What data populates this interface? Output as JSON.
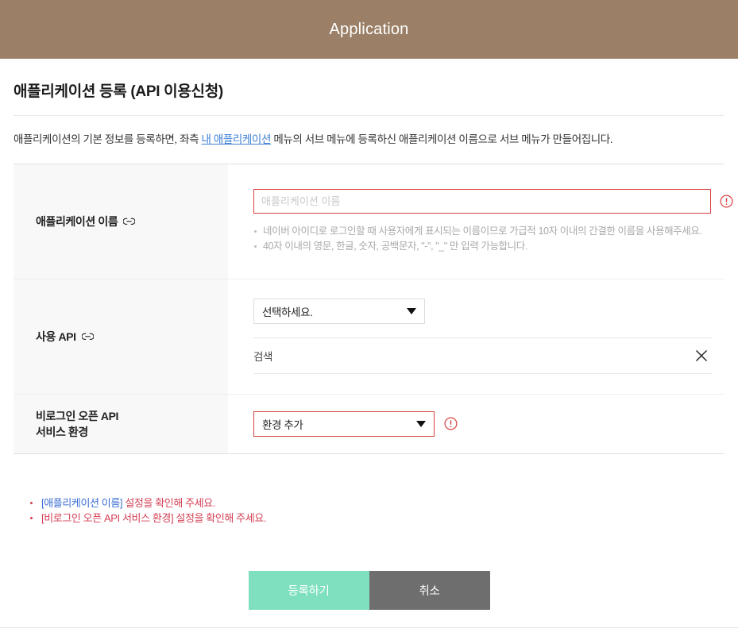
{
  "banner": {
    "title": "Application",
    "bg_color": "#9b8067"
  },
  "page": {
    "title": "애플리케이션 등록 (API 이용신청)",
    "description": {
      "before": "애플리케이션의 기본 정보를 등록하면, 좌측 ",
      "link": "내 애플리케이션",
      "after": " 메뉴의 서브 메뉴에 등록하신 애플리케이션 이름으로 서브 메뉴가 만들어집니다.",
      "link_color": "#3b7fd4"
    }
  },
  "form": {
    "app_name": {
      "label": "애플리케이션 이름",
      "link_icon": "link-icon",
      "input_placeholder": "애플리케이션 이름",
      "input_value": "",
      "warning_icon": "warning-circle-icon",
      "error_border_color": "#d94040",
      "hints": [
        "네이버 아이디로 로그인할 때 사용자에게 표시되는 이름이므로 가급적 10자 이내의 간결한 이름을 사용해주세요.",
        "40자 이내의 영문, 한글, 숫자, 공백문자, \"-\", \"_\" 만 입력 가능합니다."
      ]
    },
    "api": {
      "label": "사용 API",
      "link_icon": "link-icon",
      "select_value": "선택하세요.",
      "search_label": "검색",
      "clear_icon": "close-x-icon"
    },
    "env": {
      "label_line1": "비로그인 오픈 API",
      "label_line2": "서비스 환경",
      "select_value": "환경 추가",
      "warning_icon": "warning-circle-icon",
      "error_border_color": "#d94040"
    }
  },
  "errors": [
    {
      "bracket": "[애플리케이션 이름]",
      "bracket_color": "blue",
      "rest": " 설정을 확인해 주세요."
    },
    {
      "bracket": "[비로그인 오픈 API 서비스 환경]",
      "bracket_color": "red",
      "rest": " 설정을 확인해 주세요."
    }
  ],
  "buttons": {
    "submit": {
      "label": "등록하기",
      "color": "#7fe0c0"
    },
    "cancel": {
      "label": "취소",
      "color": "#6e6e6e"
    }
  }
}
